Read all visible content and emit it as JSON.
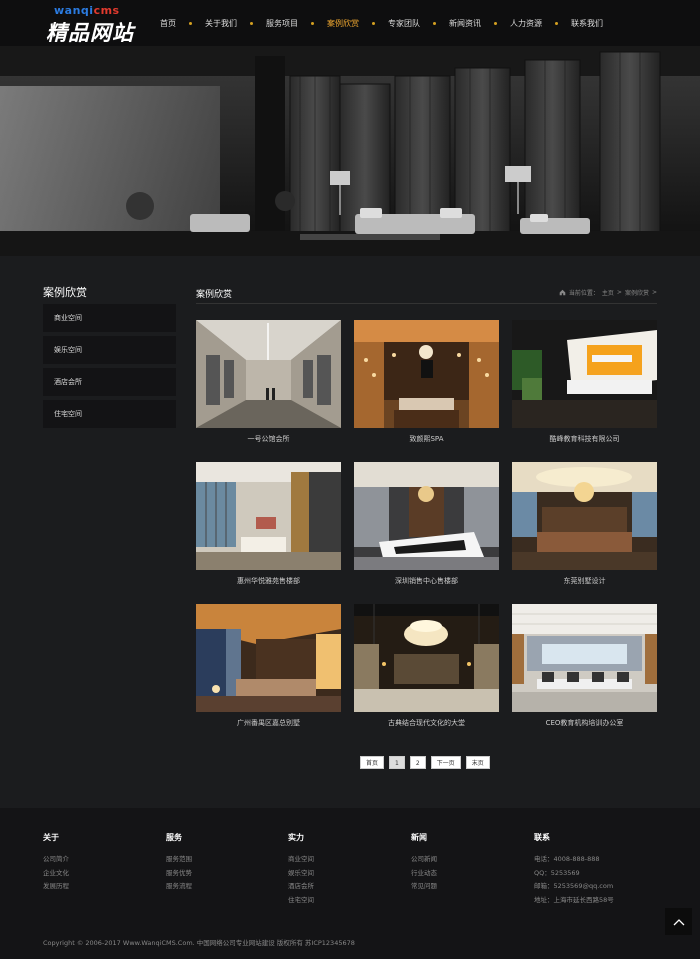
{
  "logo": {
    "sub_part1": "wanqi",
    "sub_part2": "cms",
    "main": "精品网站"
  },
  "nav": [
    {
      "label": "首页"
    },
    {
      "label": "关于我们"
    },
    {
      "label": "服务项目"
    },
    {
      "label": "案例欣赏",
      "active": true
    },
    {
      "label": "专家团队"
    },
    {
      "label": "新闻资讯"
    },
    {
      "label": "人力资源"
    },
    {
      "label": "联系我们"
    }
  ],
  "sidebar": {
    "title": "案例欣赏",
    "items": [
      "商业空间",
      "娱乐空间",
      "酒店会所",
      "住宅空间"
    ]
  },
  "main": {
    "title": "案例欣赏",
    "breadcrumb": {
      "prefix": "当前位置：",
      "home": "主页",
      "sep": ">",
      "current": "案例欣赏"
    }
  },
  "cases": [
    {
      "caption": "一号公馆会所",
      "icon": "elevator-lobby-photo"
    },
    {
      "caption": "致颜熙SPA",
      "icon": "spa-room-photo"
    },
    {
      "caption": "酷峰教育科技有限公司",
      "icon": "office-reception-photo"
    },
    {
      "caption": "惠州华悦雅苑售楼部",
      "icon": "sales-lounge-photo"
    },
    {
      "caption": "深圳销售中心售楼部",
      "icon": "sales-center-photo"
    },
    {
      "caption": "东莞别墅设计",
      "icon": "villa-living-photo"
    },
    {
      "caption": "广州番禺区嘉总别墅",
      "icon": "villa-hall-photo"
    },
    {
      "caption": "古典结合现代文化的大堂",
      "icon": "hotel-lobby-photo"
    },
    {
      "caption": "CEO教育机构培训办公室",
      "icon": "meeting-room-photo"
    }
  ],
  "pager": {
    "first": "首页",
    "p1": "1",
    "p2": "2",
    "next": "下一页",
    "last": "末页"
  },
  "footer": {
    "cols": [
      {
        "title": "关于",
        "links": [
          "公司简介",
          "企业文化",
          "发展历程"
        ]
      },
      {
        "title": "服务",
        "links": [
          "服务范围",
          "服务优势",
          "服务流程"
        ]
      },
      {
        "title": "实力",
        "links": [
          "商业空间",
          "娱乐空间",
          "酒店会所",
          "住宅空间"
        ]
      },
      {
        "title": "新闻",
        "links": [
          "公司新闻",
          "行业动态",
          "常见问题"
        ]
      },
      {
        "title": "联系",
        "links": [
          "电话：4008-888-888",
          "QQ：5253569",
          "邮箱：5253569@qq.com",
          "地址：上海市延长西路58号"
        ]
      }
    ],
    "copyright": "Copyright © 2006-2017 Www.WanqiCMS.Com. 中国网络公司专业网站建设 版权所有    苏ICP12345678"
  },
  "colors": {
    "accent": "#f0a830",
    "nav_dot": "#d4a020",
    "bg": "#1b1c1e",
    "sidebar_item": "#131315"
  }
}
